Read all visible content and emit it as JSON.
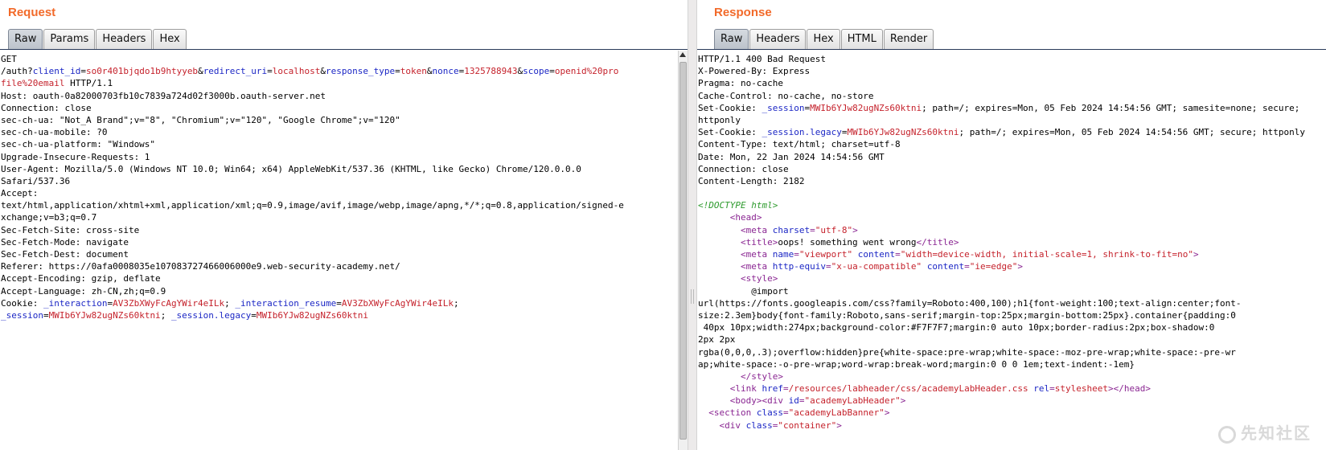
{
  "request": {
    "title": "Request",
    "tabs": [
      "Raw",
      "Params",
      "Headers",
      "Hex"
    ],
    "active_tab": "Raw",
    "lines": [
      [
        {
          "t": "GET",
          "c": ""
        }
      ],
      [
        {
          "t": "/auth?",
          "c": ""
        },
        {
          "t": "client_id",
          "c": "k"
        },
        {
          "t": "=",
          "c": ""
        },
        {
          "t": "so0r401bjqdo1b9htyyeb",
          "c": "v"
        },
        {
          "t": "&",
          "c": ""
        },
        {
          "t": "redirect_uri",
          "c": "k"
        },
        {
          "t": "=",
          "c": ""
        },
        {
          "t": "localhost",
          "c": "v"
        },
        {
          "t": "&",
          "c": ""
        },
        {
          "t": "response_type",
          "c": "k"
        },
        {
          "t": "=",
          "c": ""
        },
        {
          "t": "token",
          "c": "v"
        },
        {
          "t": "&",
          "c": ""
        },
        {
          "t": "nonce",
          "c": "k"
        },
        {
          "t": "=",
          "c": ""
        },
        {
          "t": "1325788943",
          "c": "v"
        },
        {
          "t": "&",
          "c": ""
        },
        {
          "t": "scope",
          "c": "k"
        },
        {
          "t": "=",
          "c": ""
        },
        {
          "t": "openid%20pro",
          "c": "v"
        }
      ],
      [
        {
          "t": "file%20email",
          "c": "v"
        },
        {
          "t": " HTTP/1.1",
          "c": ""
        }
      ],
      [
        {
          "t": "Host: oauth-0a82000703fb10c7839a724d02f3000b.oauth-server.net",
          "c": ""
        }
      ],
      [
        {
          "t": "Connection: close",
          "c": ""
        }
      ],
      [
        {
          "t": "sec-ch-ua: \"Not_A Brand\";v=\"8\", \"Chromium\";v=\"120\", \"Google Chrome\";v=\"120\"",
          "c": ""
        }
      ],
      [
        {
          "t": "sec-ch-ua-mobile: ?0",
          "c": ""
        }
      ],
      [
        {
          "t": "sec-ch-ua-platform: \"Windows\"",
          "c": ""
        }
      ],
      [
        {
          "t": "Upgrade-Insecure-Requests: 1",
          "c": ""
        }
      ],
      [
        {
          "t": "User-Agent: Mozilla/5.0 (Windows NT 10.0; Win64; x64) AppleWebKit/537.36 (KHTML, like Gecko) Chrome/120.0.0.0",
          "c": ""
        }
      ],
      [
        {
          "t": "Safari/537.36",
          "c": ""
        }
      ],
      [
        {
          "t": "Accept:",
          "c": ""
        }
      ],
      [
        {
          "t": "text/html,application/xhtml+xml,application/xml;q=0.9,image/avif,image/webp,image/apng,*/*;q=0.8,application/signed-e",
          "c": ""
        }
      ],
      [
        {
          "t": "xchange;v=b3;q=0.7",
          "c": ""
        }
      ],
      [
        {
          "t": "Sec-Fetch-Site: cross-site",
          "c": ""
        }
      ],
      [
        {
          "t": "Sec-Fetch-Mode: navigate",
          "c": ""
        }
      ],
      [
        {
          "t": "Sec-Fetch-Dest: document",
          "c": ""
        }
      ],
      [
        {
          "t": "Referer: https://0afa0008035e107083727466006000e9.web-security-academy.net/",
          "c": ""
        }
      ],
      [
        {
          "t": "Accept-Encoding: gzip, deflate",
          "c": ""
        }
      ],
      [
        {
          "t": "Accept-Language: zh-CN,zh;q=0.9",
          "c": ""
        }
      ],
      [
        {
          "t": "Cookie: ",
          "c": ""
        },
        {
          "t": "_interaction",
          "c": "k"
        },
        {
          "t": "=",
          "c": ""
        },
        {
          "t": "AV3ZbXWyFcAgYWir4eILk",
          "c": "v"
        },
        {
          "t": "; ",
          "c": ""
        },
        {
          "t": "_interaction_resume",
          "c": "k"
        },
        {
          "t": "=",
          "c": ""
        },
        {
          "t": "AV3ZbXWyFcAgYWir4eILk",
          "c": "v"
        },
        {
          "t": ";",
          "c": ""
        }
      ],
      [
        {
          "t": "_session",
          "c": "k"
        },
        {
          "t": "=",
          "c": ""
        },
        {
          "t": "MWIb6YJw82ugNZs60ktni",
          "c": "v"
        },
        {
          "t": "; ",
          "c": ""
        },
        {
          "t": "_session.legacy",
          "c": "k"
        },
        {
          "t": "=",
          "c": ""
        },
        {
          "t": "MWIb6YJw82ugNZs60ktni",
          "c": "v"
        }
      ]
    ]
  },
  "response": {
    "title": "Response",
    "tabs": [
      "Raw",
      "Headers",
      "Hex",
      "HTML",
      "Render"
    ],
    "active_tab": "Raw",
    "lines": [
      [
        {
          "t": "HTTP/1.1 400 Bad Request",
          "c": ""
        }
      ],
      [
        {
          "t": "X-Powered-By: Express",
          "c": ""
        }
      ],
      [
        {
          "t": "Pragma: no-cache",
          "c": ""
        }
      ],
      [
        {
          "t": "Cache-Control: no-cache, no-store",
          "c": ""
        }
      ],
      [
        {
          "t": "Set-Cookie: ",
          "c": ""
        },
        {
          "t": "_session",
          "c": "k"
        },
        {
          "t": "=",
          "c": ""
        },
        {
          "t": "MWIb6YJw82ugNZs60ktni",
          "c": "v"
        },
        {
          "t": "; path=/; expires=Mon, 05 Feb 2024 14:54:56 GMT; samesite=none; secure;",
          "c": ""
        }
      ],
      [
        {
          "t": "httponly",
          "c": ""
        }
      ],
      [
        {
          "t": "Set-Cookie: ",
          "c": ""
        },
        {
          "t": "_session.legacy",
          "c": "k"
        },
        {
          "t": "=",
          "c": ""
        },
        {
          "t": "MWIb6YJw82ugNZs60ktni",
          "c": "v"
        },
        {
          "t": "; path=/; expires=Mon, 05 Feb 2024 14:54:56 GMT; secure; httponly",
          "c": ""
        }
      ],
      [
        {
          "t": "Content-Type: text/html; charset=utf-8",
          "c": ""
        }
      ],
      [
        {
          "t": "Date: Mon, 22 Jan 2024 14:54:56 GMT",
          "c": ""
        }
      ],
      [
        {
          "t": "Connection: close",
          "c": ""
        }
      ],
      [
        {
          "t": "Content-Length: 2182",
          "c": ""
        }
      ],
      [
        {
          "t": "",
          "c": ""
        }
      ],
      [
        {
          "t": "<!DOCTYPE html>",
          "c": "d"
        }
      ],
      [
        {
          "t": "      ",
          "c": ""
        },
        {
          "t": "<head>",
          "c": "t"
        }
      ],
      [
        {
          "t": "        ",
          "c": ""
        },
        {
          "t": "<meta ",
          "c": "t"
        },
        {
          "t": "charset",
          "c": "k"
        },
        {
          "t": "=",
          "c": "t"
        },
        {
          "t": "\"utf-8\"",
          "c": "v"
        },
        {
          "t": ">",
          "c": "t"
        }
      ],
      [
        {
          "t": "        ",
          "c": ""
        },
        {
          "t": "<title>",
          "c": "t"
        },
        {
          "t": "oops! something went wrong",
          "c": ""
        },
        {
          "t": "</title>",
          "c": "t"
        }
      ],
      [
        {
          "t": "        ",
          "c": ""
        },
        {
          "t": "<meta ",
          "c": "t"
        },
        {
          "t": "name",
          "c": "k"
        },
        {
          "t": "=",
          "c": "t"
        },
        {
          "t": "\"viewport\"",
          "c": "v"
        },
        {
          "t": " ",
          "c": ""
        },
        {
          "t": "content",
          "c": "k"
        },
        {
          "t": "=",
          "c": "t"
        },
        {
          "t": "\"width=device-width, initial-scale=1, shrink-to-fit=no\"",
          "c": "v"
        },
        {
          "t": ">",
          "c": "t"
        }
      ],
      [
        {
          "t": "        ",
          "c": ""
        },
        {
          "t": "<meta ",
          "c": "t"
        },
        {
          "t": "http-equiv",
          "c": "k"
        },
        {
          "t": "=",
          "c": "t"
        },
        {
          "t": "\"x-ua-compatible\"",
          "c": "v"
        },
        {
          "t": " ",
          "c": ""
        },
        {
          "t": "content",
          "c": "k"
        },
        {
          "t": "=",
          "c": "t"
        },
        {
          "t": "\"ie=edge\"",
          "c": "v"
        },
        {
          "t": ">",
          "c": "t"
        }
      ],
      [
        {
          "t": "        ",
          "c": ""
        },
        {
          "t": "<style>",
          "c": "t"
        }
      ],
      [
        {
          "t": "          @import",
          "c": ""
        }
      ],
      [
        {
          "t": "url(https://fonts.googleapis.com/css?family=Roboto:400,100);h1{font-weight:100;text-align:center;font-",
          "c": ""
        }
      ],
      [
        {
          "t": "size:2.3em}body{font-family:Roboto,sans-serif;margin-top:25px;margin-bottom:25px}.container{padding:0",
          "c": ""
        }
      ],
      [
        {
          "t": " 40px 10px;width:274px;background-color:#F7F7F7;margin:0 auto 10px;border-radius:2px;box-shadow:0",
          "c": ""
        }
      ],
      [
        {
          "t": "2px 2px",
          "c": ""
        }
      ],
      [
        {
          "t": "rgba(0,0,0,.3);overflow:hidden}pre{white-space:pre-wrap;white-space:-moz-pre-wrap;white-space:-pre-wr",
          "c": ""
        }
      ],
      [
        {
          "t": "ap;white-space:-o-pre-wrap;word-wrap:break-word;margin:0 0 0 1em;text-indent:-1em}",
          "c": ""
        }
      ],
      [
        {
          "t": "        ",
          "c": ""
        },
        {
          "t": "</style>",
          "c": "t"
        }
      ],
      [
        {
          "t": "      ",
          "c": ""
        },
        {
          "t": "<link ",
          "c": "t"
        },
        {
          "t": "href",
          "c": "k"
        },
        {
          "t": "=",
          "c": "t"
        },
        {
          "t": "/resources/labheader/css/academyLabHeader.css",
          "c": "v"
        },
        {
          "t": " ",
          "c": ""
        },
        {
          "t": "rel",
          "c": "k"
        },
        {
          "t": "=",
          "c": "t"
        },
        {
          "t": "stylesheet",
          "c": "v"
        },
        {
          "t": "></head>",
          "c": "t"
        }
      ],
      [
        {
          "t": "      ",
          "c": ""
        },
        {
          "t": "<body>",
          "c": "t"
        },
        {
          "t": "<div ",
          "c": "t"
        },
        {
          "t": "id",
          "c": "k"
        },
        {
          "t": "=",
          "c": "t"
        },
        {
          "t": "\"academyLabHeader\"",
          "c": "v"
        },
        {
          "t": ">",
          "c": "t"
        }
      ],
      [
        {
          "t": "  ",
          "c": ""
        },
        {
          "t": "<section ",
          "c": "t"
        },
        {
          "t": "class",
          "c": "k"
        },
        {
          "t": "=",
          "c": "t"
        },
        {
          "t": "\"academyLabBanner\"",
          "c": "v"
        },
        {
          "t": ">",
          "c": "t"
        }
      ],
      [
        {
          "t": "    ",
          "c": ""
        },
        {
          "t": "<div ",
          "c": "t"
        },
        {
          "t": "class",
          "c": "k"
        },
        {
          "t": "=",
          "c": "t"
        },
        {
          "t": "\"container\"",
          "c": "v"
        },
        {
          "t": ">",
          "c": "t"
        }
      ]
    ]
  },
  "watermark": "先知社区",
  "colors": {
    "title": "#f26a2a",
    "param": "#1c27c5",
    "value": "#c5222c",
    "tag": "#8a2692",
    "doctype": "#2d9a2d"
  }
}
